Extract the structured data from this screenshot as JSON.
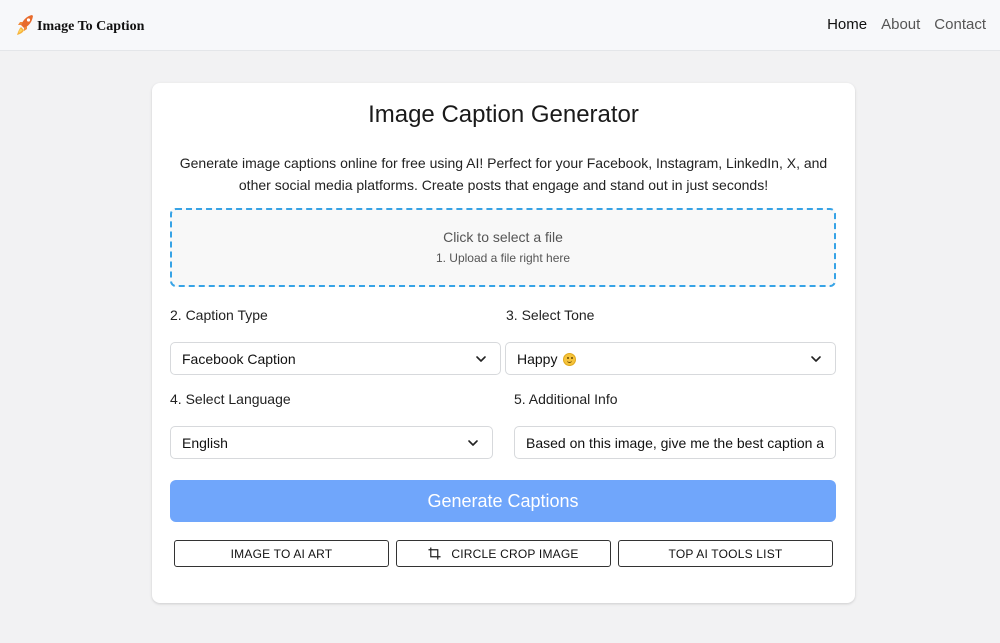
{
  "header": {
    "brand": "Image To Caption",
    "nav": [
      {
        "label": "Home",
        "active": true
      },
      {
        "label": "About",
        "active": false
      },
      {
        "label": "Contact",
        "active": false
      }
    ]
  },
  "main": {
    "title": "Image Caption Generator",
    "description": "Generate image captions online for free using AI! Perfect for your Facebook, Instagram, LinkedIn, X, and other social media platforms. Create posts that engage and stand out in just seconds!",
    "upload": {
      "primary": "Click to select a file",
      "secondary": "1. Upload a file right here"
    },
    "caption_type": {
      "label": "2. Caption Type",
      "value": "Facebook Caption"
    },
    "tone": {
      "label": "3. Select Tone",
      "value": "Happy",
      "icon": "smiley-emoji-icon"
    },
    "language": {
      "label": "4. Select Language",
      "value": "English"
    },
    "additional_info": {
      "label": "5. Additional Info",
      "value": "Based on this image, give me the best caption a"
    },
    "generate_label": "Generate Captions",
    "links": [
      {
        "label": "IMAGE TO AI ART"
      },
      {
        "label": "CIRCLE CROP IMAGE",
        "icon": "crop-icon"
      },
      {
        "label": "TOP AI TOOLS LIST"
      }
    ]
  },
  "colors": {
    "accent_blue": "#70a6fb",
    "dropzone_border": "#37a3e6",
    "background": "#f2f2f3"
  }
}
